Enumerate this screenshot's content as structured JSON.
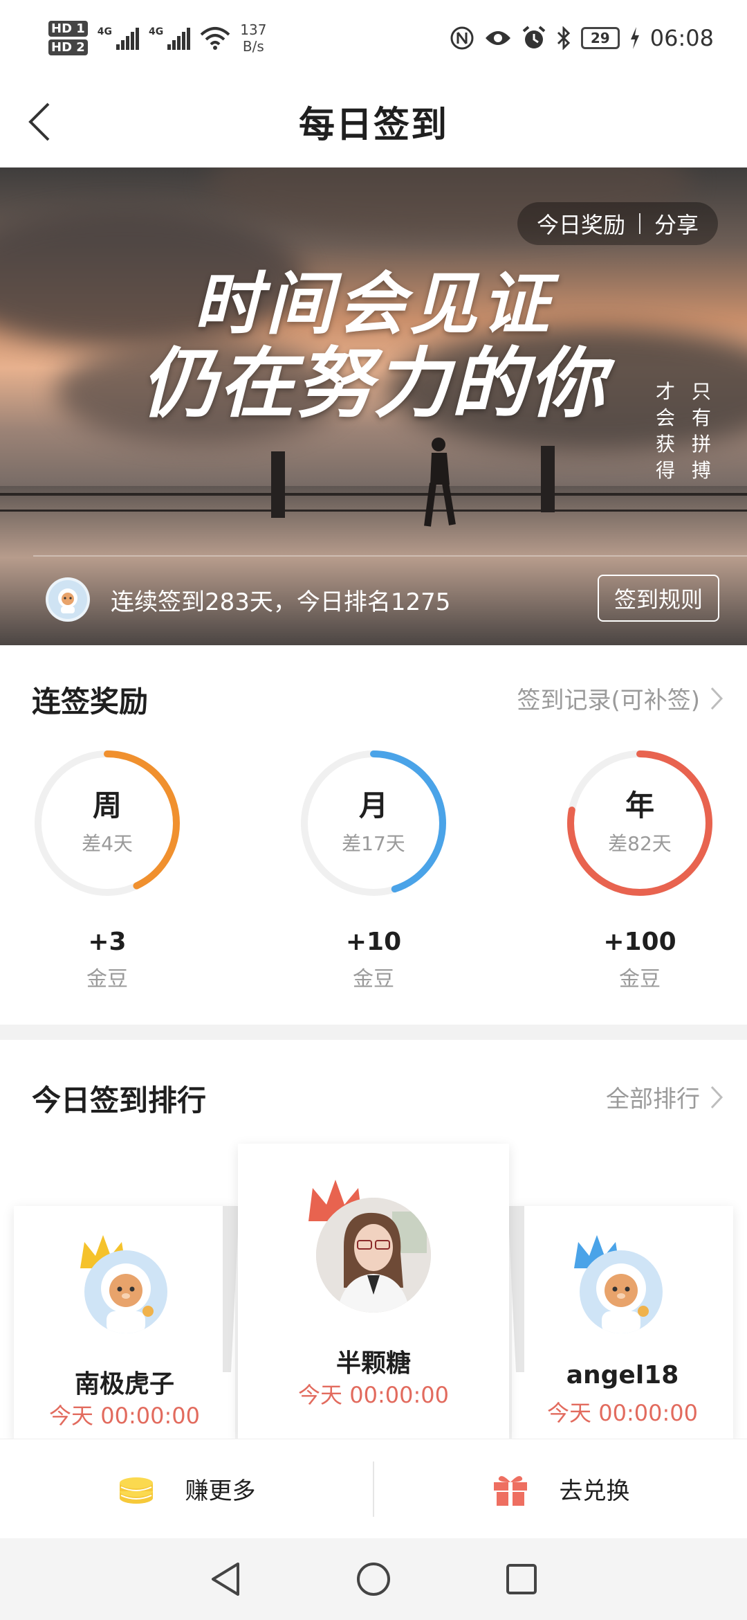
{
  "status_bar": {
    "hd1": "HD 1",
    "hd2": "HD 2",
    "net1": "4G",
    "net2": "4G",
    "speed_value": "137",
    "speed_unit": "B/s",
    "battery": "29",
    "time": "06:08"
  },
  "header": {
    "title": "每日签到"
  },
  "banner": {
    "reward_link": "今日奖励",
    "share_link": "分享",
    "slogan_line1": "时间会见证",
    "slogan_line2": "仍在努力的你",
    "vertical_right": [
      "只",
      "有",
      "拼",
      "搏"
    ],
    "vertical_left": [
      "才",
      "会",
      "获",
      "得"
    ],
    "status_text": "连续签到283天，今日排名1275",
    "rules_button": "签到规则"
  },
  "streak": {
    "title": "连签奖励",
    "record_link": "签到记录(可补签)",
    "items": [
      {
        "label": "周",
        "remaining": "差4天",
        "amount": "+3",
        "unit": "金豆",
        "progress": 0.43,
        "color": "#f0902e"
      },
      {
        "label": "月",
        "remaining": "差17天",
        "amount": "+10",
        "unit": "金豆",
        "progress": 0.45,
        "color": "#4aa3e8"
      },
      {
        "label": "年",
        "remaining": "差82天",
        "amount": "+100",
        "unit": "金豆",
        "progress": 0.78,
        "color": "#e8634f"
      }
    ]
  },
  "ranking": {
    "title": "今日签到排行",
    "all_link": "全部排行",
    "entries": [
      {
        "name": "南极虎子",
        "time": "今天 00:00:00",
        "crown": "#f5c22b"
      },
      {
        "name": "半颗糖",
        "time": "今天 00:00:00",
        "crown": "#e8634f"
      },
      {
        "name": "angel18",
        "time": "今天 00:00:00",
        "crown": "#4aa3e8"
      }
    ]
  },
  "bottom_actions": {
    "earn_more": "赚更多",
    "exchange": "去兑换"
  },
  "colors": {
    "accent_red": "#e26b5e",
    "coin_yellow": "#f6c93a",
    "gift_red": "#ee6f61"
  }
}
